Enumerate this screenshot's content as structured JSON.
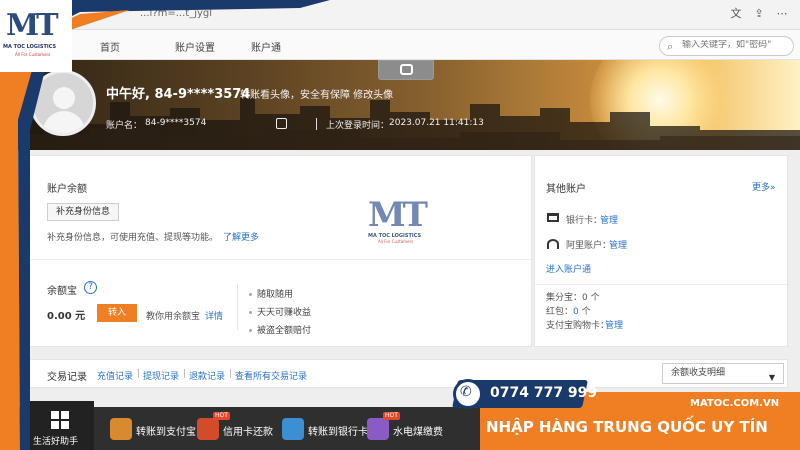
{
  "browser": {
    "url": "...i?m=...t_jygl"
  },
  "nav": {
    "items": [
      "首页",
      "账户设置",
      "账户通"
    ],
    "search_placeholder": "输入关键字，如\"密码\""
  },
  "banner": {
    "greeting": "中午好, 84-9****3574",
    "greeting_sub": "转账看头像，安全有保障 修改头像",
    "account_label": "账户名：",
    "account_value": "84-9****3574",
    "login_label": "上次登录时间：",
    "login_value": "2023.07.21 11:41:13"
  },
  "balance": {
    "title": "账户余额",
    "verify_button": "补充身份信息",
    "note": "补充身份信息，可使用充值、提现等功能。",
    "note_link": "了解更多",
    "yeb_title": "余额宝",
    "amount": "0.00 元",
    "transfer_button": "转入",
    "teach_text": "教你用余额宝",
    "teach_link": "详情",
    "features": [
      "随取随用",
      "天天可赚收益",
      "被盗全额赔付"
    ]
  },
  "other": {
    "title": "其他账户",
    "more": "更多»",
    "bank_label": "银行卡：",
    "bank_link": "管理",
    "ali_label": "阿里账户：",
    "ali_link": "管理",
    "enter_link": "进入账户通",
    "jifen": "集分宝：0 个",
    "hongbao_label": "红包：",
    "hongbao_val": "0",
    "hongbao_unit": " 个",
    "gouwu_label": "支付宝购物卡：",
    "gouwu_link": "管理"
  },
  "trade": {
    "title": "交易记录",
    "links": [
      "充值记录",
      "提现记录",
      "退款记录",
      "查看所有交易记录"
    ],
    "select_value": "余额收支明细"
  },
  "taskbar": {
    "help_label": "生活好助手",
    "items": [
      {
        "label": "转账到支付宝",
        "color": "#d88a2e"
      },
      {
        "label": "信用卡还款",
        "color": "#d24b2a",
        "hot": "HOT"
      },
      {
        "label": "转账到银行卡",
        "color": "#3c8fd1"
      },
      {
        "label": "水电煤缴费",
        "color": "#8a5bc5",
        "hot": "HOT"
      }
    ]
  },
  "brand": {
    "logo": "MT",
    "logo_sub1": "MA TOC LOGISTICS",
    "logo_sub2": "All For Customers",
    "phone": "0774 777 999",
    "site": "MATOC.COM.VN",
    "slogan": "NHẬP HÀNG TRUNG QUỐC UY TÍN"
  }
}
